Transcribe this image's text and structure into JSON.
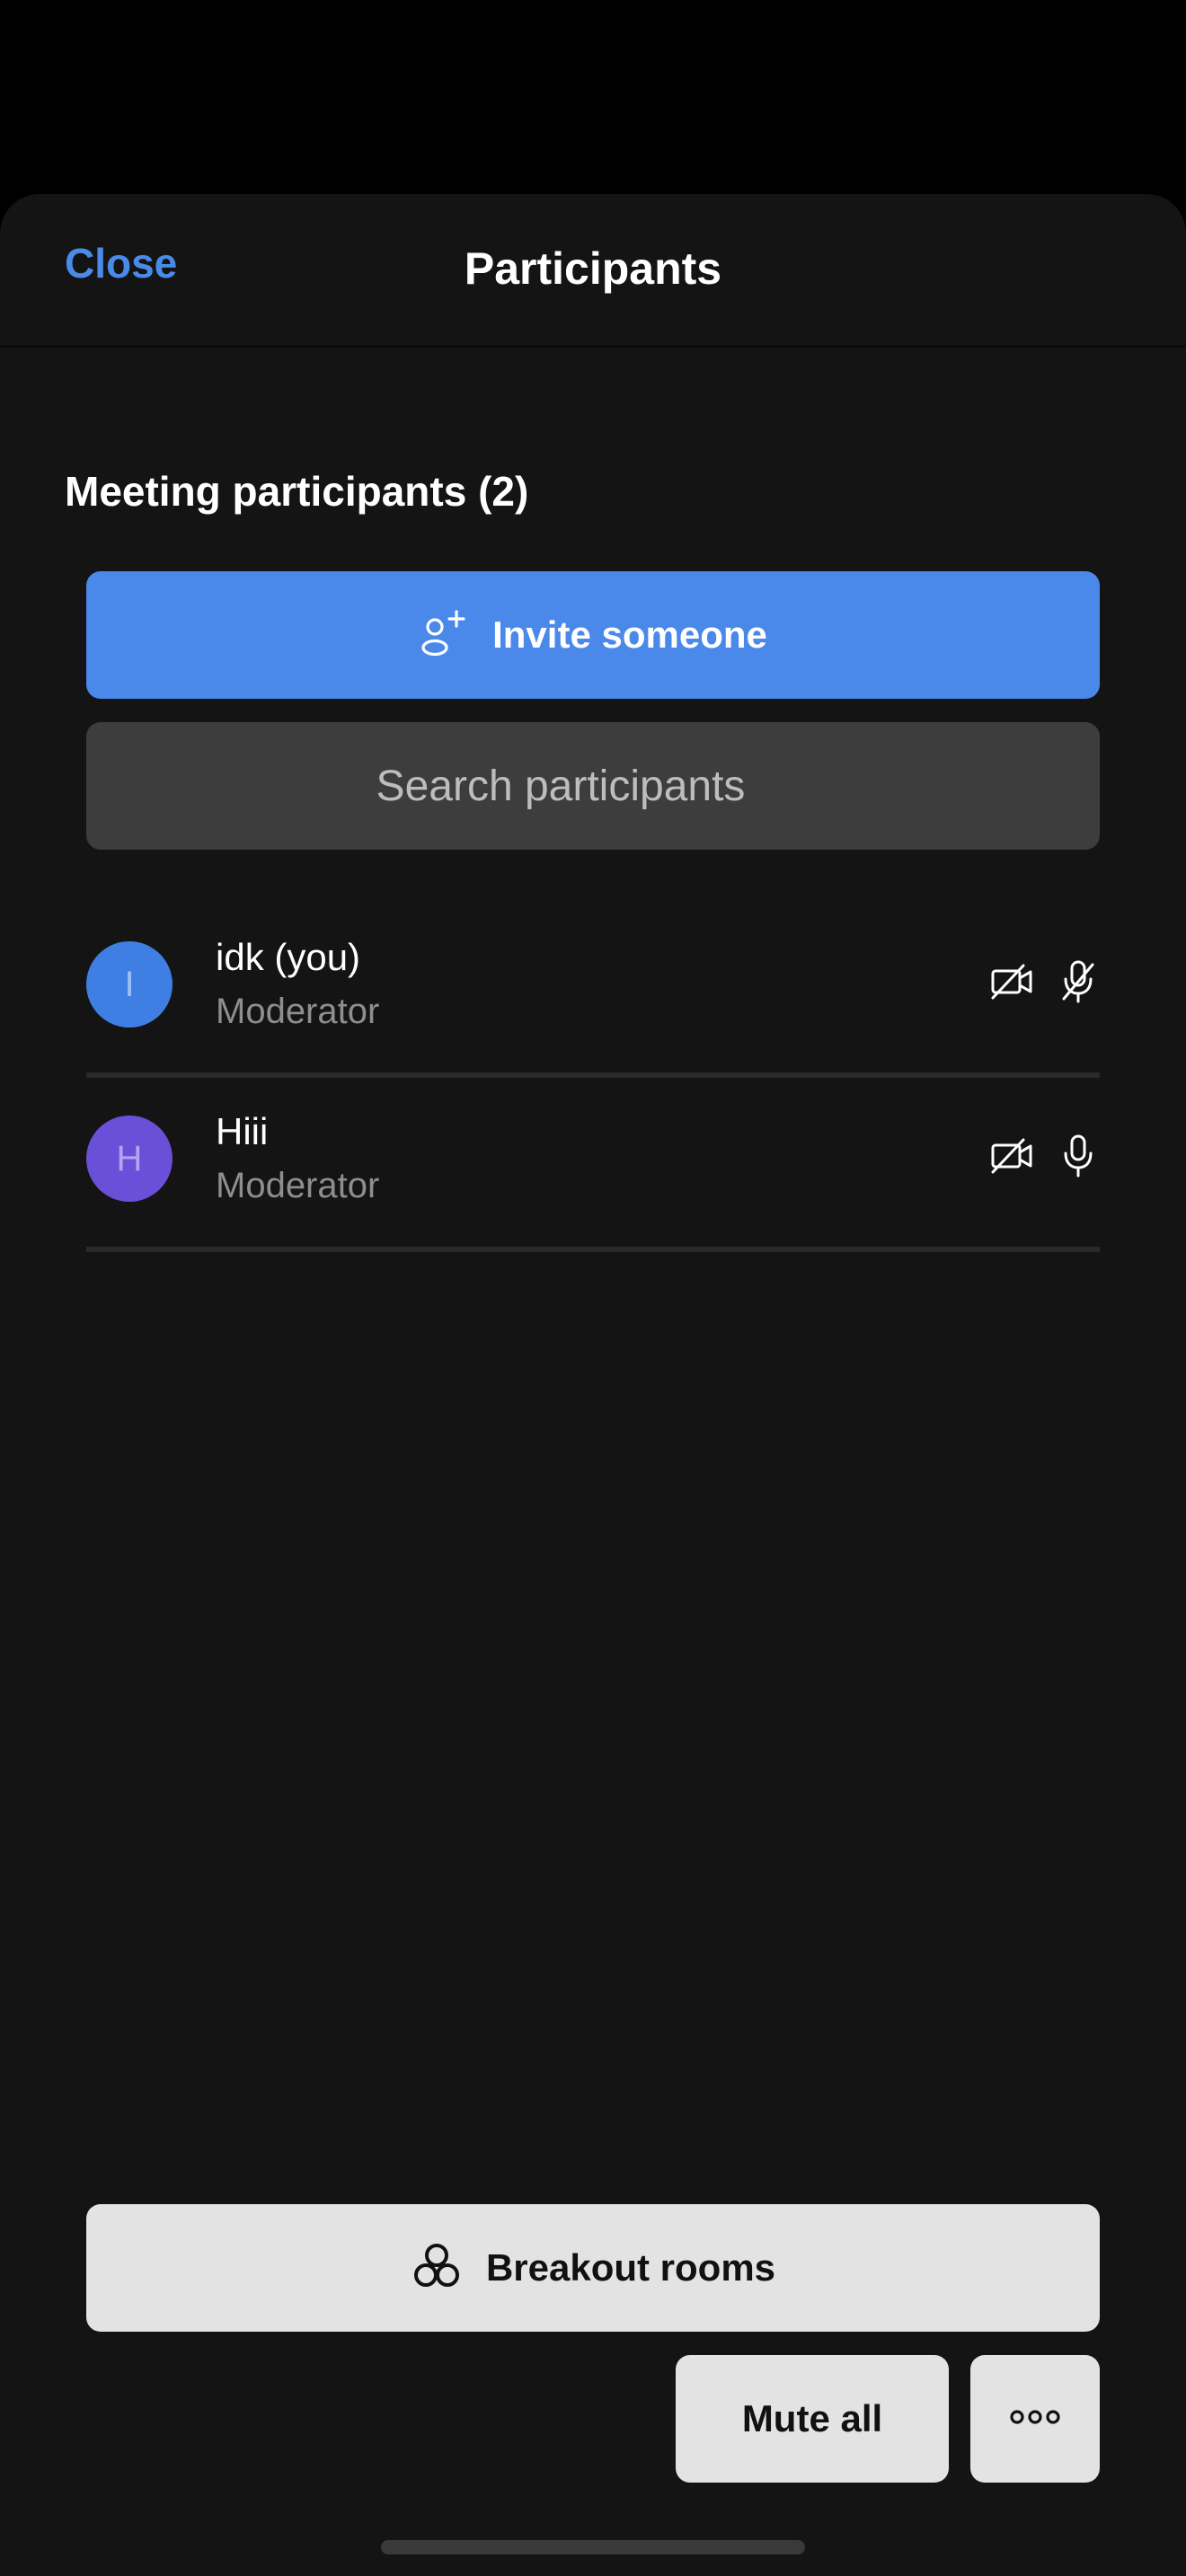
{
  "header": {
    "close_label": "Close",
    "title": "Participants"
  },
  "section": {
    "title": "Meeting participants (2)"
  },
  "invite": {
    "label": "Invite someone",
    "icon": "add-person-icon"
  },
  "search": {
    "placeholder": "Search participants"
  },
  "participants": [
    {
      "initial": "I",
      "name": "idk (you)",
      "role": "Moderator",
      "avatar_color": "#3f7fe3",
      "camera_icon": "camera-off-icon",
      "mic_icon": "mic-off-icon"
    },
    {
      "initial": "H",
      "name": "Hiii",
      "role": "Moderator",
      "avatar_color": "#6a4fd8",
      "camera_icon": "camera-off-icon",
      "mic_icon": "mic-on-icon"
    }
  ],
  "footer": {
    "breakout_label": "Breakout rooms",
    "breakout_icon": "breakout-rooms-icon",
    "mute_all_label": "Mute all",
    "more_icon": "more-options-icon"
  },
  "colors": {
    "accent": "#4a89ea",
    "background": "#141414",
    "button_light": "#e3e3e3"
  }
}
